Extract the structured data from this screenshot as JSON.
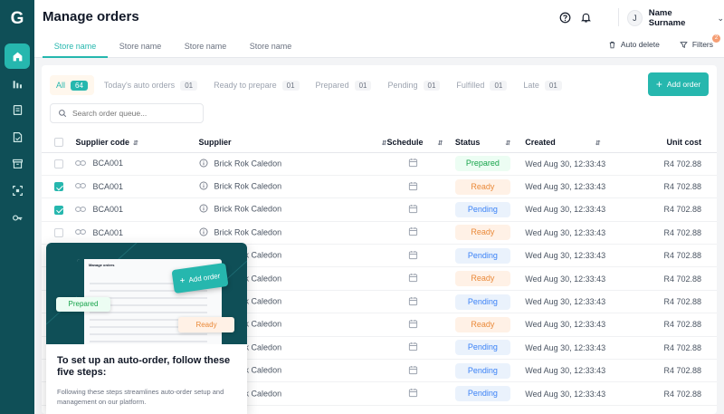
{
  "app": {
    "logo": "G",
    "page_title": "Manage orders"
  },
  "sidebar": {
    "items": [
      {
        "icon": "home-icon",
        "active": true
      },
      {
        "icon": "bar-chart-icon",
        "active": false
      },
      {
        "icon": "document-icon",
        "active": false
      },
      {
        "icon": "file-check-icon",
        "active": false
      },
      {
        "icon": "archive-icon",
        "active": false
      },
      {
        "icon": "scan-icon",
        "active": false
      },
      {
        "icon": "key-icon",
        "active": false
      }
    ]
  },
  "user": {
    "initial": "J",
    "name": "Name Surname"
  },
  "store_tabs": [
    "Store name",
    "Store name",
    "Store name",
    "Store name"
  ],
  "top_actions": {
    "auto_delete": "Auto delete",
    "filters": "Filters",
    "filters_badge": "2"
  },
  "status_tabs": [
    {
      "label": "All",
      "count": "64",
      "active": true
    },
    {
      "label": "Today's auto orders",
      "count": "01",
      "active": false
    },
    {
      "label": "Ready to prepare",
      "count": "01",
      "active": false
    },
    {
      "label": "Prepared",
      "count": "01",
      "active": false
    },
    {
      "label": "Pending",
      "count": "01",
      "active": false
    },
    {
      "label": "Fulfilled",
      "count": "01",
      "active": false
    },
    {
      "label": "Late",
      "count": "01",
      "active": false
    }
  ],
  "add_order_label": "Add order",
  "search": {
    "placeholder": "Search order queue..."
  },
  "table": {
    "columns": [
      "Supplier code",
      "Supplier",
      "Schedule",
      "Status",
      "Created",
      "Unit cost"
    ],
    "rows": [
      {
        "checked": false,
        "code": "BCA001",
        "supplier": "Brick Rok Caledon",
        "status": "Prepared",
        "created": "Wed Aug 30, 12:33:43",
        "cost": "R4 702.88"
      },
      {
        "checked": true,
        "code": "BCA001",
        "supplier": "Brick Rok Caledon",
        "status": "Ready",
        "created": "Wed Aug 30, 12:33:43",
        "cost": "R4 702.88"
      },
      {
        "checked": true,
        "code": "BCA001",
        "supplier": "Brick Rok Caledon",
        "status": "Pending",
        "created": "Wed Aug 30, 12:33:43",
        "cost": "R4 702.88"
      },
      {
        "checked": false,
        "code": "BCA001",
        "supplier": "Brick Rok Caledon",
        "status": "Ready",
        "created": "Wed Aug 30, 12:33:43",
        "cost": "R4 702.88"
      },
      {
        "checked": false,
        "code": "",
        "supplier": "Brick Rok Caledon",
        "status": "Pending",
        "created": "Wed Aug 30, 12:33:43",
        "cost": "R4 702.88"
      },
      {
        "checked": false,
        "code": "",
        "supplier": "Brick Rok Caledon",
        "status": "Ready",
        "created": "Wed Aug 30, 12:33:43",
        "cost": "R4 702.88"
      },
      {
        "checked": false,
        "code": "",
        "supplier": "Brick Rok Caledon",
        "status": "Pending",
        "created": "Wed Aug 30, 12:33:43",
        "cost": "R4 702.88"
      },
      {
        "checked": false,
        "code": "",
        "supplier": "Brick Rok Caledon",
        "status": "Ready",
        "created": "Wed Aug 30, 12:33:43",
        "cost": "R4 702.88"
      },
      {
        "checked": false,
        "code": "",
        "supplier": "Brick Rok Caledon",
        "status": "Pending",
        "created": "Wed Aug 30, 12:33:43",
        "cost": "R4 702.88"
      },
      {
        "checked": false,
        "code": "",
        "supplier": "Brick Rok Caledon",
        "status": "Pending",
        "created": "Wed Aug 30, 12:33:43",
        "cost": "R4 702.88"
      },
      {
        "checked": false,
        "code": "",
        "supplier": "Brick Rok Caledon",
        "status": "Pending",
        "created": "Wed Aug 30, 12:33:43",
        "cost": "R4 702.88"
      }
    ]
  },
  "onboarding": {
    "mock_title": "Manage orders",
    "mock_add_label": "Add order",
    "mock_prepared": "Prepared",
    "mock_ready": "Ready",
    "title": "To set up an auto-order, follow these five steps:",
    "description": "Following these steps streamlines auto-order setup and management on our platform."
  },
  "colors": {
    "accent": "#26b7ae",
    "sidebar": "#0f4f57"
  }
}
